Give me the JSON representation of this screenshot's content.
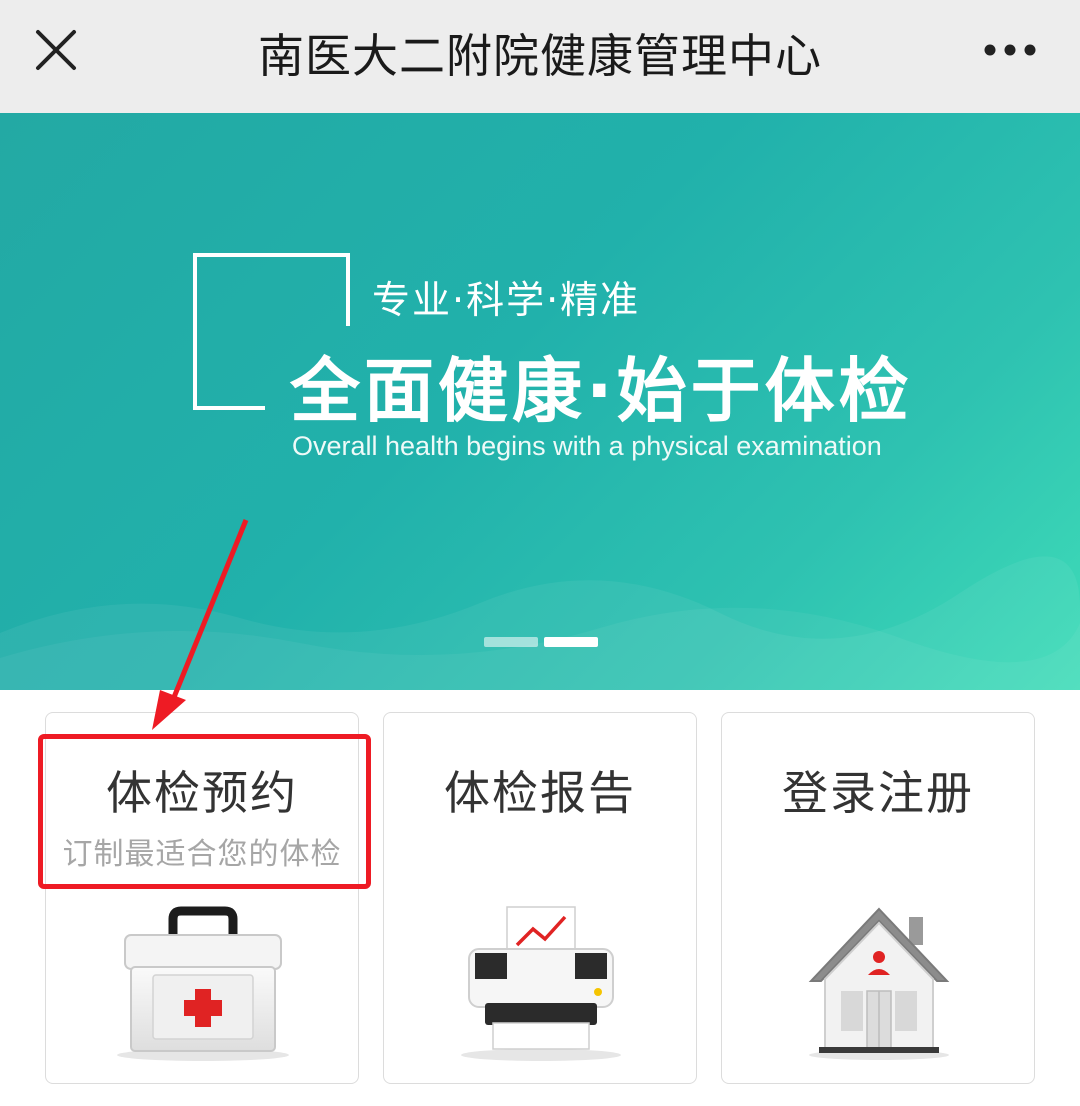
{
  "header": {
    "title": "南医大二附院健康管理中心"
  },
  "banner": {
    "slogan_small": "专业·科学·精准",
    "slogan_big": "全面健康·始于体检",
    "slogan_en": "Overall health begins with a physical examination",
    "slides_count": 2,
    "active_slide": 2
  },
  "cards": [
    {
      "title": "体检预约",
      "subtitle": "订制最适合您的体检",
      "icon": "medical-kit-icon"
    },
    {
      "title": "体检报告",
      "subtitle": "",
      "icon": "printer-report-icon"
    },
    {
      "title": "登录注册",
      "subtitle": "",
      "icon": "house-user-icon"
    }
  ],
  "colors": {
    "banner_start": "#23a9a4",
    "banner_end": "#3fdcb8",
    "highlight": "#ee1b24",
    "card_border": "#dcdcdc"
  }
}
